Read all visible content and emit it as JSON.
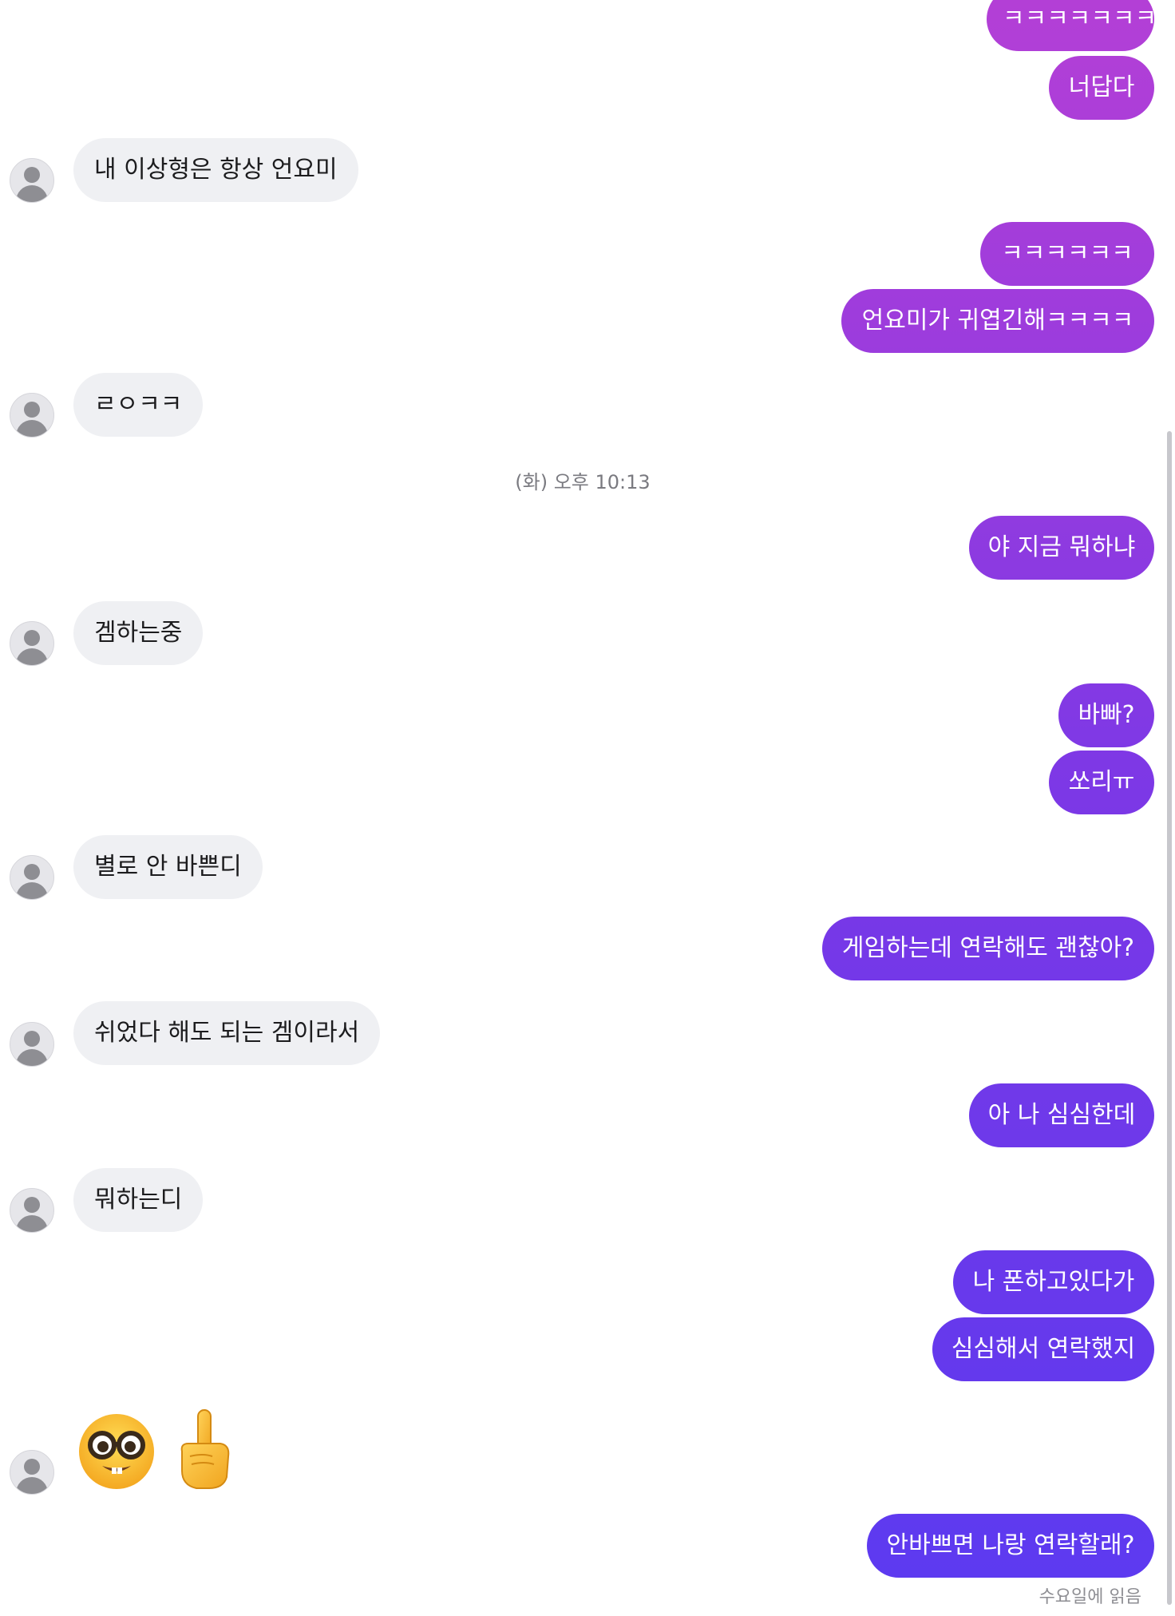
{
  "colors": {
    "received_bubble": "#eff0f3",
    "sent_gradient_top": "#b43fd6",
    "sent_gradient_mid": "#7b38e6",
    "sent_gradient_bottom": "#5b3af0"
  },
  "messages": [
    {
      "side": "sent",
      "text": "ㅋㅋㅋㅋㅋㅋㅋㅋ"
    },
    {
      "side": "sent",
      "text": "너답다"
    },
    {
      "side": "received",
      "text": "내 이상형은 항상 언요미"
    },
    {
      "side": "sent",
      "text": "ㅋㅋㅋㅋㅋㅋ"
    },
    {
      "side": "sent",
      "text": "언요미가 귀엽긴해ㅋㅋㅋㅋ"
    },
    {
      "side": "received",
      "text": "ㄹㅇㅋㅋ"
    },
    {
      "side": "timestamp",
      "text": "(화) 오후 10:13"
    },
    {
      "side": "sent",
      "text": "야 지금 뭐하냐"
    },
    {
      "side": "received",
      "text": "겜하는중"
    },
    {
      "side": "sent",
      "text": "바빠?"
    },
    {
      "side": "sent",
      "text": "쏘리ㅠ"
    },
    {
      "side": "received",
      "text": "별로 안 바쁜디"
    },
    {
      "side": "sent",
      "text": "게임하는데 연락해도 괜찮아?"
    },
    {
      "side": "received",
      "text": "쉬었다 해도 되는 겜이라서"
    },
    {
      "side": "sent",
      "text": "아 나 심심한데"
    },
    {
      "side": "received",
      "text": "뭐하는디"
    },
    {
      "side": "sent",
      "text": "나 폰하고있다가"
    },
    {
      "side": "sent",
      "text": "심심해서 연락했지"
    },
    {
      "side": "received_emoji",
      "icons": [
        "nerd-face-emoji",
        "pointing-up-emoji"
      ]
    },
    {
      "side": "sent",
      "text": "안바쁘면 나랑 연락할래?"
    }
  ],
  "read_receipt": "수요일에 읽음"
}
